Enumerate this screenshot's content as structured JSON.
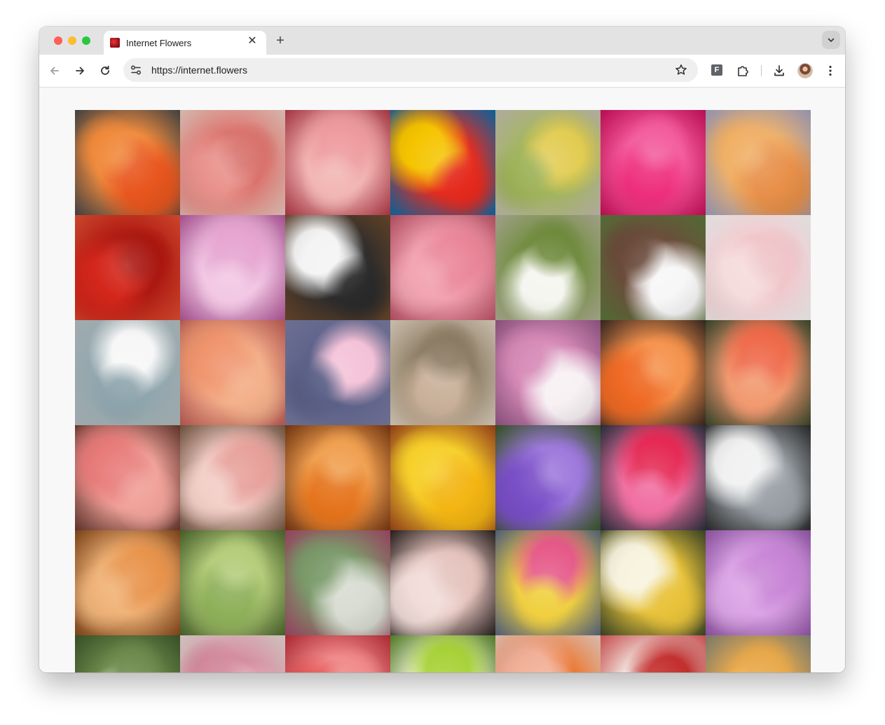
{
  "browser": {
    "tab": {
      "title": "Internet Flowers",
      "close_glyph": "✕"
    },
    "new_tab_glyph": "+",
    "address": {
      "url": "https://internet.flowers"
    },
    "extension_label": "F",
    "icons": [
      "close-icon",
      "plus-icon",
      "chevron-down-icon",
      "back-arrow-icon",
      "forward-arrow-icon",
      "reload-icon",
      "site-settings-icon",
      "bookmark-star-icon",
      "extensions-puzzle-icon",
      "download-icon",
      "kebab-menu-icon"
    ]
  },
  "colors": {
    "traffic_close": "#ff5f57",
    "traffic_minimize": "#febc2e",
    "traffic_zoom": "#28c840",
    "tabstrip": "#e3e3e3",
    "page_background": "#f8f8f8"
  },
  "flower_tiles": [
    {
      "name": "orange-pincushion-protea",
      "colors": [
        "#e8561e",
        "#f08a3c",
        "#4a4a4a"
      ]
    },
    {
      "name": "pink-rose-closeup",
      "colors": [
        "#e9928c",
        "#d8706a",
        "#f3d1c5"
      ]
    },
    {
      "name": "pink-carnations",
      "colors": [
        "#ee9a9d",
        "#f2b7b4",
        "#b93a4a"
      ]
    },
    {
      "name": "smiling-cartoon-sunflower",
      "colors": [
        "#f5c400",
        "#e52a1e",
        "#0a6fb0"
      ]
    },
    {
      "name": "yellow-flower-buckets",
      "colors": [
        "#e2cc52",
        "#9fb35a",
        "#c9c3b4"
      ]
    },
    {
      "name": "magenta-dahlia",
      "colors": [
        "#ee2f7d",
        "#f35c9d",
        "#d20f5d"
      ]
    },
    {
      "name": "blurry-orange-bouquet",
      "colors": [
        "#e8904a",
        "#f0b066",
        "#a6a6c6"
      ]
    },
    {
      "name": "red-blurry-flowers",
      "colors": [
        "#d4261a",
        "#a8150e",
        "#e85032"
      ]
    },
    {
      "name": "pink-alstroemeria",
      "colors": [
        "#e6a4d0",
        "#f2c8e4",
        "#b95aa0"
      ]
    },
    {
      "name": "white-anemone",
      "colors": [
        "#f4f4f4",
        "#2a2a2a",
        "#6f4a2c"
      ]
    },
    {
      "name": "pink-rose",
      "colors": [
        "#ea8598",
        "#f2a4b2",
        "#c5566c"
      ]
    },
    {
      "name": "white-jasmine",
      "colors": [
        "#f6f6f0",
        "#6e8a3c",
        "#b6b69a"
      ]
    },
    {
      "name": "white-blossom-shrub",
      "colors": [
        "#f7f7f7",
        "#6a4a3a",
        "#5e7a3c"
      ]
    },
    {
      "name": "pale-pink-flower",
      "colors": [
        "#f6dcdc",
        "#efc4c8",
        "#ffffff"
      ]
    },
    {
      "name": "white-lotus-on-grey",
      "colors": [
        "#f7f7f7",
        "#8ea4ac",
        "#b8c4c6"
      ]
    },
    {
      "name": "blurry-peach-box",
      "colors": [
        "#f0956e",
        "#f3b08a",
        "#c7605a"
      ]
    },
    {
      "name": "pink-hibiscus-icon",
      "colors": [
        "#f4c2d8",
        "#5a5f86",
        "#7c7fa6"
      ]
    },
    {
      "name": "blurry-beige-flower",
      "colors": [
        "#c9b09a",
        "#8a7a62",
        "#e6d8c4"
      ]
    },
    {
      "name": "white-pink-mix",
      "colors": [
        "#f7f1f4",
        "#d68ab6",
        "#9a5a8c"
      ]
    },
    {
      "name": "orange-dahlia",
      "colors": [
        "#ef6a24",
        "#f5924c",
        "#3a2a22"
      ]
    },
    {
      "name": "orange-rose",
      "colors": [
        "#ef6a4a",
        "#f29a70",
        "#3c4a2e"
      ]
    },
    {
      "name": "pink-ranunculus",
      "colors": [
        "#e87c7a",
        "#f0a29a",
        "#6b3a30"
      ]
    },
    {
      "name": "peach-rose",
      "colors": [
        "#e7a09a",
        "#f3cfc8",
        "#7a5a44"
      ]
    },
    {
      "name": "orange-roses-bunch",
      "colors": [
        "#e5741c",
        "#f0a050",
        "#7d3a12"
      ]
    },
    {
      "name": "yellow-gazania",
      "colors": [
        "#f3b512",
        "#f7d02a",
        "#a3451c"
      ]
    },
    {
      "name": "purple-aster",
      "colors": [
        "#7a4fc7",
        "#9c78dc",
        "#3a5a24"
      ]
    },
    {
      "name": "pink-bouquet-pot",
      "colors": [
        "#e52a55",
        "#f070a2",
        "#2a3140"
      ]
    },
    {
      "name": "white-orchids",
      "colors": [
        "#f1f1f1",
        "#9aa0a6",
        "#2c2c2c"
      ]
    },
    {
      "name": "peach-ranunculus",
      "colors": [
        "#e8934a",
        "#f0b47a",
        "#8a4a1a"
      ]
    },
    {
      "name": "green-succulent",
      "colors": [
        "#8fb05a",
        "#b4cc7a",
        "#4e6a2e"
      ]
    },
    {
      "name": "white-kale-flower",
      "colors": [
        "#d8dcd2",
        "#7a9a6a",
        "#a84a6a"
      ]
    },
    {
      "name": "blush-peony",
      "colors": [
        "#f1dcd8",
        "#e4c2bc",
        "#2a2220"
      ]
    },
    {
      "name": "mixed-bouquet-basket",
      "colors": [
        "#e65a8a",
        "#f0d040",
        "#5a6a88"
      ]
    },
    {
      "name": "cream-cosmos",
      "colors": [
        "#f7f3de",
        "#e8c23a",
        "#3e4a28"
      ]
    },
    {
      "name": "lilac-hydrangea",
      "colors": [
        "#c884d6",
        "#dca6e6",
        "#9a5ab0"
      ]
    },
    {
      "name": "white-blossom-tree",
      "colors": [
        "#eef0e6",
        "#6e8a4c",
        "#3e5a2c"
      ]
    },
    {
      "name": "soft-pink-blur",
      "colors": [
        "#e8b4c0",
        "#d28a9c",
        "#ecdcd8"
      ]
    },
    {
      "name": "red-pink-mix",
      "colors": [
        "#e04a4a",
        "#f08a8a",
        "#c0303a"
      ]
    },
    {
      "name": "lime-green-flower",
      "colors": [
        "#a8d23a",
        "#f5f5e0",
        "#5a8a2a"
      ]
    },
    {
      "name": "peach-orange-flower",
      "colors": [
        "#f2b098",
        "#e8742e",
        "#f6d6c6"
      ]
    },
    {
      "name": "red-white-blur",
      "colors": [
        "#c43030",
        "#f0e6e0",
        "#e05a5a"
      ]
    },
    {
      "name": "yellow-orchid-branch",
      "colors": [
        "#f3c876",
        "#e8a84a",
        "#8a8a7a"
      ]
    }
  ]
}
